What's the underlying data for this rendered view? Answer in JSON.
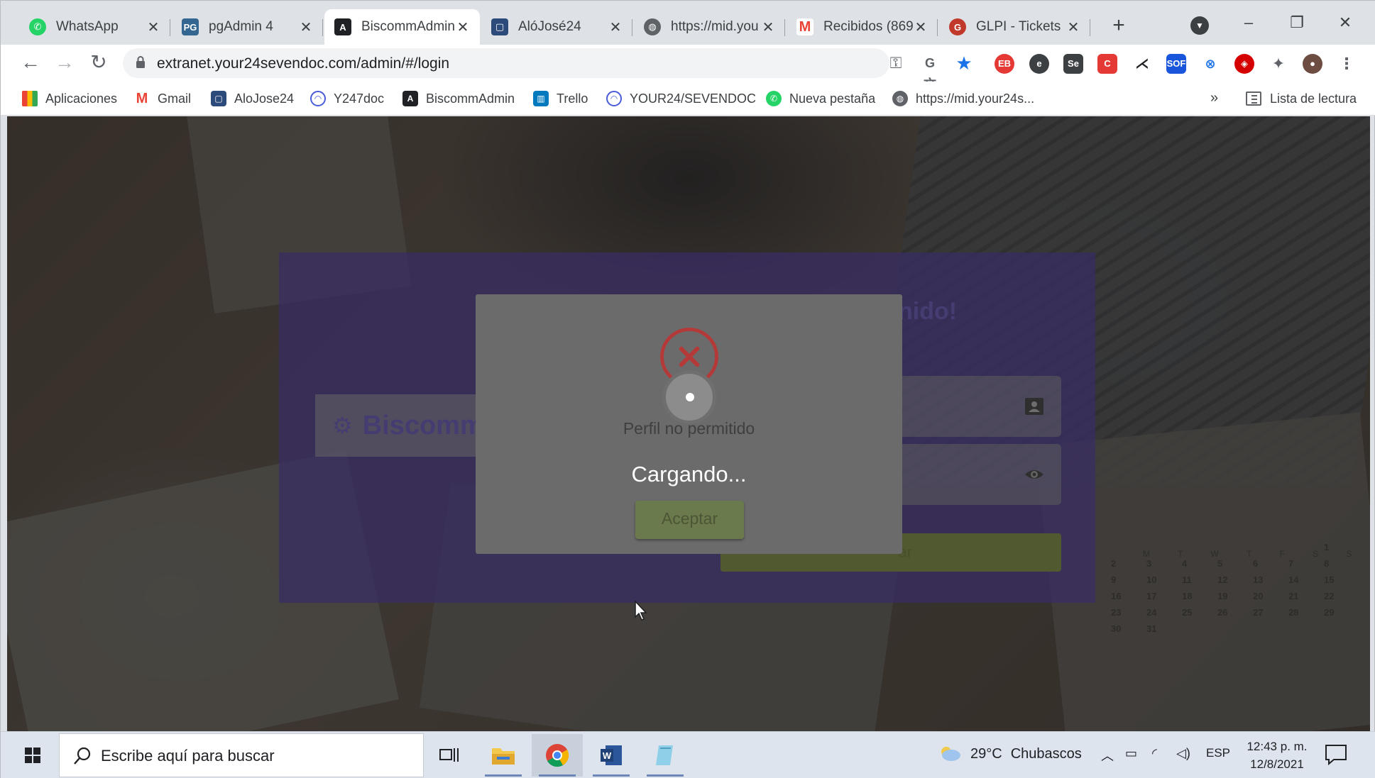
{
  "browser": {
    "tabs": [
      {
        "label": "WhatsApp",
        "icon": "whatsapp-icon",
        "color": "#25d366"
      },
      {
        "label": "pgAdmin 4",
        "icon": "pgadmin-icon",
        "color": "#336791"
      },
      {
        "label": "BiscommAdmin",
        "icon": "angular-icon",
        "color": "#202124",
        "active": true
      },
      {
        "label": "AlóJosé24",
        "icon": "alojose-icon",
        "color": "#2c4a7a"
      },
      {
        "label": "https://mid.you",
        "icon": "globe-icon",
        "color": "#5f6368"
      },
      {
        "label": "Recibidos (869",
        "icon": "gmail-icon",
        "color": "#ea4335"
      },
      {
        "label": "GLPI - Tickets",
        "icon": "glpi-icon",
        "color": "#c0392b"
      }
    ],
    "address": "extranet.your24sevendoc.com/admin/#/login",
    "bookmarks": [
      {
        "label": "Aplicaciones",
        "icon": "apps-grid-icon",
        "color": "#ea4335"
      },
      {
        "label": "Gmail",
        "icon": "gmail-icon",
        "color": "#ea4335"
      },
      {
        "label": "AloJose24",
        "icon": "alojose-icon",
        "color": "#2c4a7a"
      },
      {
        "label": "Y247doc",
        "icon": "y247doc-icon",
        "color": "#4a5bd8"
      },
      {
        "label": "BiscommAdmin",
        "icon": "angular-icon",
        "color": "#202124"
      },
      {
        "label": "Trello",
        "icon": "trello-icon",
        "color": "#0079bf"
      },
      {
        "label": "YOUR24/SEVENDOC",
        "icon": "your24-icon",
        "color": "#4a5bd8"
      },
      {
        "label": "Nueva pestaña",
        "icon": "whatsapp-icon",
        "color": "#25d366"
      },
      {
        "label": "https://mid.your24s...",
        "icon": "globe-icon",
        "color": "#5f6368"
      }
    ],
    "more_bookmarks": "»",
    "reading_list": "Lista de lectura"
  },
  "page": {
    "brand": "Biscomm",
    "welcome": "nido!",
    "login_button": "ar",
    "accent_color": "#4834a0"
  },
  "modal": {
    "message": "Perfil no permitido",
    "accept_label": "Aceptar",
    "loading_text": "Cargando...",
    "error_color": "#b43a3a"
  },
  "taskbar": {
    "search_placeholder": "Escribe aquí para buscar",
    "weather_temp": "29°C",
    "weather_desc": "Chubascos",
    "language": "ESP",
    "time": "12:43 p. m.",
    "date": "12/8/2021"
  },
  "calendar": {
    "header": "M T W T F S S",
    "days": [
      "",
      "",
      "",
      "",
      "",
      "",
      "1",
      "2",
      "3",
      "4",
      "5",
      "6",
      "7",
      "8",
      "9",
      "10",
      "11",
      "12",
      "13",
      "14",
      "15",
      "16",
      "17",
      "18",
      "19",
      "20",
      "21",
      "22",
      "23",
      "24",
      "25",
      "26",
      "27",
      "28",
      "29",
      "30",
      "31"
    ]
  }
}
